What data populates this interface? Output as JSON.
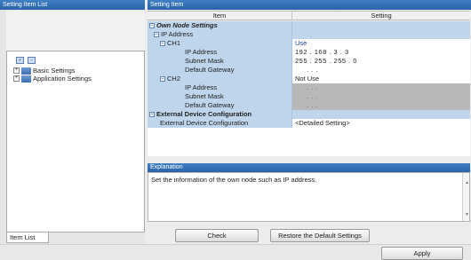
{
  "left_pane": {
    "title": "Setting Item List",
    "tree": [
      {
        "label": "Basic Settings"
      },
      {
        "label": "Application Settings"
      }
    ],
    "tab_label": "Item List"
  },
  "right_pane": {
    "title": "Setting Item",
    "columns": {
      "item": "Item",
      "setting": "Setting"
    },
    "rows": [
      {
        "item": "Own Node Settings",
        "setting": ""
      },
      {
        "item": "IP Address",
        "setting": ""
      },
      {
        "item": "CH1",
        "setting": "Use"
      },
      {
        "item": "IP Address",
        "setting": "192 . 168 .  3 .  3"
      },
      {
        "item": "Subnet Mask",
        "setting": "255 . 255 . 255 .  0"
      },
      {
        "item": "Default Gateway",
        "setting": ".   .   ."
      },
      {
        "item": "CH2",
        "setting": "Not Use"
      },
      {
        "item": "IP Address",
        "setting": ".   .   ."
      },
      {
        "item": "Subnet Mask",
        "setting": ".   .   ."
      },
      {
        "item": "Default Gateway",
        "setting": ".   .   ."
      },
      {
        "item": "External Device Configuration",
        "setting": ""
      },
      {
        "item": "External Device Configuration",
        "setting": "<Detailed Setting>"
      }
    ],
    "explanation_title": "Explanation",
    "explanation_text": "Set the information of the own node such as IP address."
  },
  "buttons": {
    "check": "Check",
    "restore": "Restore the Default Settings",
    "apply": "Apply"
  }
}
